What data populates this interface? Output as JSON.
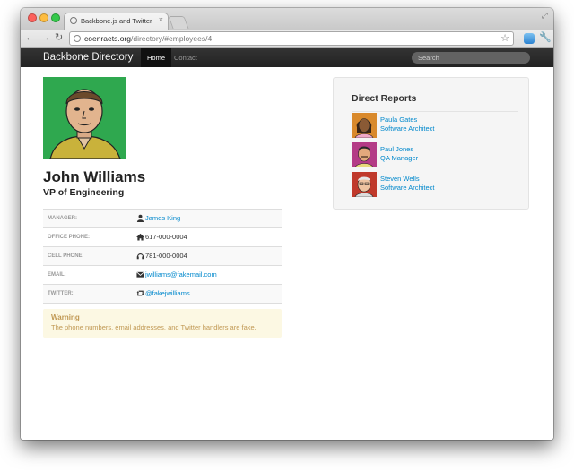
{
  "browser": {
    "tab_title": "Backbone.js and Twitter Boo",
    "url_host": "coenraets.org",
    "url_path": "/directory/#employees/4"
  },
  "navbar": {
    "brand": "Backbone Directory",
    "items": [
      {
        "label": "Home"
      },
      {
        "label": "Contact"
      }
    ],
    "search_placeholder": "Search"
  },
  "employee": {
    "name": "John Williams",
    "title": "VP of Engineering",
    "details": [
      {
        "label": "MANAGER:",
        "value": "James King",
        "icon": "user-icon"
      },
      {
        "label": "OFFICE PHONE:",
        "value": "617-000-0004",
        "icon": "home-icon"
      },
      {
        "label": "CELL PHONE:",
        "value": "781-000-0004",
        "icon": "headphones-icon"
      },
      {
        "label": "EMAIL:",
        "value": "jwilliams@fakemail.com",
        "icon": "envelope-icon"
      },
      {
        "label": "TWITTER:",
        "value": "@fakejwilliams",
        "icon": "retweet-icon"
      }
    ]
  },
  "warning": {
    "title": "Warning",
    "text": "The phone numbers, email addresses, and Twitter handlers are fake."
  },
  "reports": {
    "title": "Direct Reports",
    "items": [
      {
        "name": "Paula Gates",
        "title": "Software Architect"
      },
      {
        "name": "Paul Jones",
        "title": "QA Manager"
      },
      {
        "name": "Steven Wells",
        "title": "Software Architect"
      }
    ]
  },
  "colors": {
    "navbar": "#222222",
    "link": "#0088cc",
    "avatar_bg": "#2fa84f",
    "warning_bg": "#fcf8e3",
    "warning_text": "#c09853"
  }
}
